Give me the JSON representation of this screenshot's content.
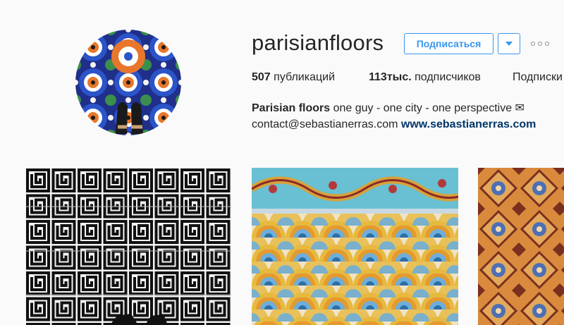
{
  "profile": {
    "username": "parisianfloors",
    "follow_label": "Подписаться",
    "dropdown_glyph": "▾",
    "avatar_alt": "parisianfloors"
  },
  "stats": {
    "posts_count": "507",
    "posts_label": "публикаций",
    "followers_count": "113тыс.",
    "followers_label": "подписчиков",
    "following_label": "Подписки"
  },
  "bio": {
    "name": "Parisian floors",
    "text": "one guy - one city - one perspective ✉",
    "email": "contact@sebastianerras.com",
    "link": "www.sebastianerras.com"
  },
  "colors": {
    "accent": "#3897f0",
    "link": "#003569",
    "background": "#fafafa"
  },
  "posts": [
    {
      "name": "black-white-meander-tiles"
    },
    {
      "name": "mosaic-fish-scale-floor"
    },
    {
      "name": "orange-encaustic-tiles"
    }
  ]
}
